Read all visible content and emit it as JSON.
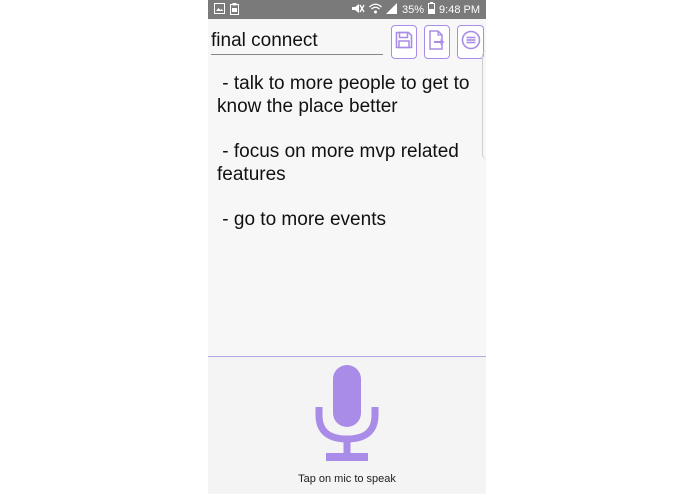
{
  "status_bar": {
    "battery": "35%",
    "time": "9:48 PM",
    "left_icons": [
      "image-icon",
      "clipboard-icon"
    ],
    "right_icons": [
      "mute-icon",
      "wifi-icon",
      "signal-icon",
      "battery-icon"
    ]
  },
  "header": {
    "title_value": "final connect",
    "buttons": [
      "save-icon",
      "export-icon",
      "menu-icon"
    ]
  },
  "note": {
    "lines": [
      " - talk to more people to get to know the place better",
      " - focus on more mvp related features",
      " - go to more events"
    ]
  },
  "mic": {
    "hint": "Tap on mic to speak",
    "icon": "microphone-icon"
  },
  "colors": {
    "accent": "#a98ce8",
    "status_bar": "#7a7a7a",
    "background": "#f7f7f7"
  }
}
